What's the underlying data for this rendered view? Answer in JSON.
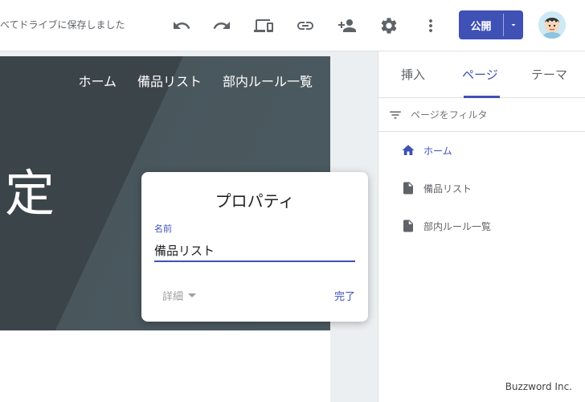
{
  "topbar": {
    "save_status": "べてドライブに保存しました",
    "publish_label": "公開"
  },
  "canvas": {
    "nav_items": [
      "ホーム",
      "備品リスト",
      "部内ルール一覧"
    ],
    "hero_title": "定"
  },
  "properties_dialog": {
    "title": "プロパティ",
    "name_label": "名前",
    "name_value": "備品リスト",
    "details_label": "詳細",
    "done_label": "完了"
  },
  "panel": {
    "tabs": [
      "挿入",
      "ページ",
      "テーマ"
    ],
    "filter_placeholder": "ページをフィルタ",
    "pages": [
      {
        "label": "ホーム",
        "icon": "home-icon"
      },
      {
        "label": "備品リスト",
        "icon": "page-icon"
      },
      {
        "label": "部内ルール一覧",
        "icon": "page-icon"
      }
    ]
  },
  "watermark": "Buzzword Inc.",
  "colors": {
    "accent": "#3f51b5",
    "hero": "#3b4449"
  }
}
